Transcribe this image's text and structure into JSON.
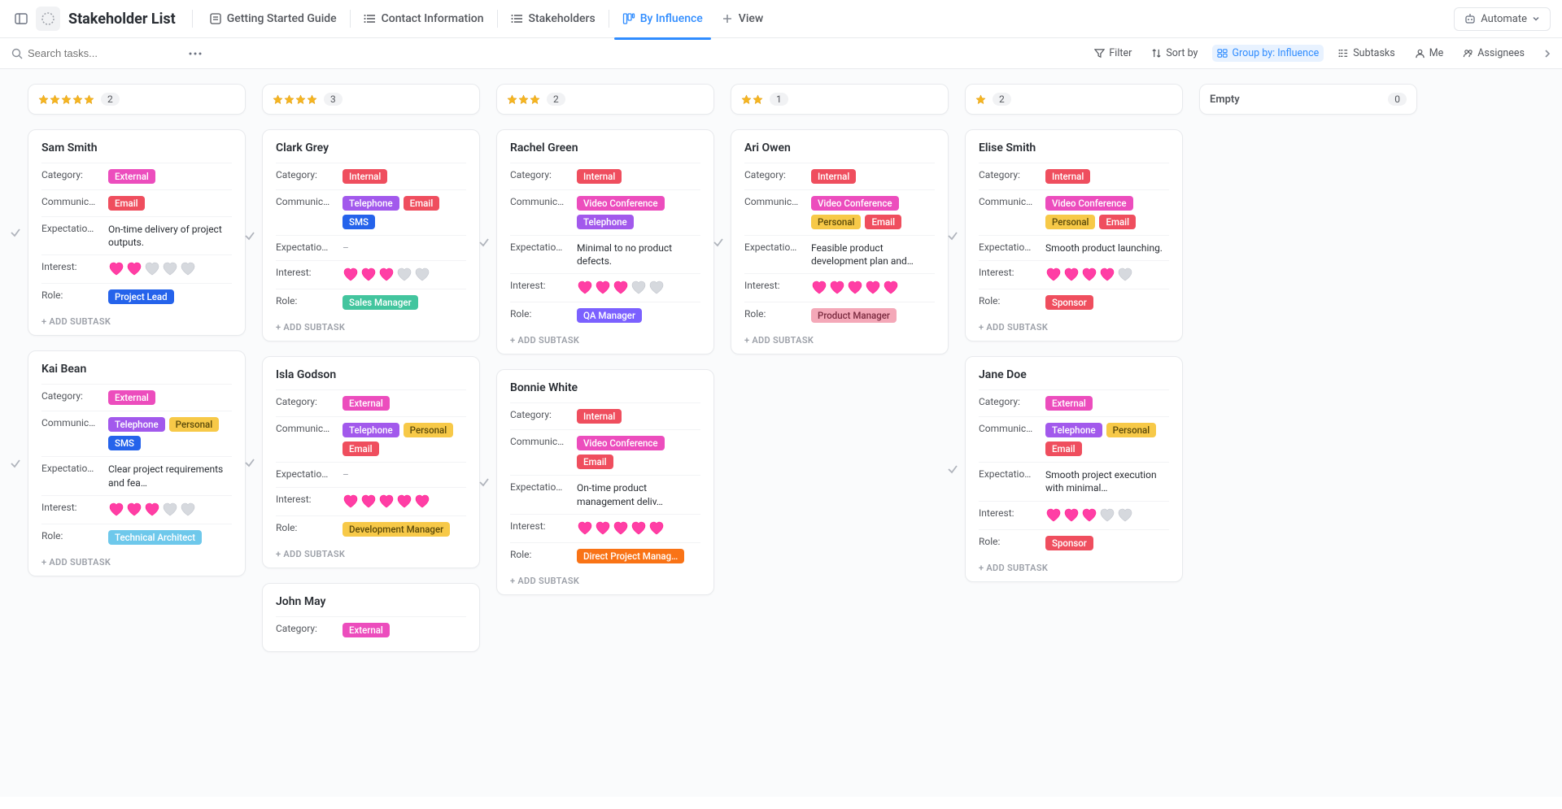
{
  "header": {
    "title": "Stakeholder List",
    "tabs": [
      {
        "label": "Getting Started Guide",
        "active": false
      },
      {
        "label": "Contact Information",
        "active": false
      },
      {
        "label": "Stakeholders",
        "active": false
      },
      {
        "label": "By Influence",
        "active": true
      },
      {
        "label": "View",
        "active": false,
        "isAdd": true
      }
    ],
    "automate": "Automate"
  },
  "toolbar": {
    "search_placeholder": "Search tasks...",
    "items": [
      {
        "icon": "filter",
        "label": "Filter",
        "highlight": false
      },
      {
        "icon": "sort",
        "label": "Sort by",
        "highlight": false
      },
      {
        "icon": "group",
        "label": "Group by: Influence",
        "highlight": true
      },
      {
        "icon": "subtasks",
        "label": "Subtasks",
        "highlight": false
      },
      {
        "icon": "me",
        "label": "Me",
        "highlight": false
      },
      {
        "icon": "assignees",
        "label": "Assignees",
        "highlight": false
      }
    ]
  },
  "labels": {
    "category": "Category:",
    "communication": "Communic…",
    "expectation": "Expectatio…",
    "interest": "Interest:",
    "role": "Role:",
    "add_subtask": "+ ADD SUBTASK",
    "empty": "Empty"
  },
  "tag_colors": {
    "External": "t-external",
    "Internal": "t-internal",
    "Email": "t-email",
    "Telephone": "t-telephone",
    "SMS": "t-sms",
    "Personal": "t-personal",
    "Video Conference": "t-video",
    "Project Lead": "t-project-lead",
    "Sales Manager": "t-sales-manager",
    "Technical Architect": "t-tech-architect",
    "Development Manager": "t-dev-manager",
    "QA Manager": "t-qa-manager",
    "Direct Project Manag…": "t-direct-pm",
    "Product Manager": "t-product-manager",
    "Sponsor": "t-sponsor"
  },
  "columns": [
    {
      "stars": 5,
      "count": 2,
      "cards": [
        {
          "name": "Sam Smith",
          "category": [
            "External"
          ],
          "communication": [
            "Email"
          ],
          "expectation": "On-time delivery of project outputs.",
          "interest": 2,
          "role": [
            "Project Lead"
          ]
        },
        {
          "name": "Kai Bean",
          "category": [
            "External"
          ],
          "communication": [
            "Telephone",
            "Personal",
            "SMS"
          ],
          "expectation": "Clear project requirements and fea…",
          "interest": 3,
          "role": [
            "Technical Architect"
          ]
        }
      ]
    },
    {
      "stars": 4,
      "count": 3,
      "cards": [
        {
          "name": "Clark Grey",
          "category": [
            "Internal"
          ],
          "communication": [
            "Telephone",
            "Email",
            "SMS"
          ],
          "expectation": "–",
          "interest": 3,
          "role": [
            "Sales Manager"
          ]
        },
        {
          "name": "Isla Godson",
          "category": [
            "External"
          ],
          "communication": [
            "Telephone",
            "Personal",
            "Email"
          ],
          "expectation": "–",
          "interest": 5,
          "role": [
            "Development Manager"
          ]
        },
        {
          "name": "John May",
          "category": [
            "External"
          ],
          "communication": [],
          "expectation": null,
          "interest": null,
          "role": [],
          "truncated": true
        }
      ]
    },
    {
      "stars": 3,
      "count": 2,
      "cards": [
        {
          "name": "Rachel Green",
          "category": [
            "Internal"
          ],
          "communication": [
            "Video Conference",
            "Telephone"
          ],
          "expectation": "Minimal to no product defects.",
          "interest": 3,
          "role": [
            "QA Manager"
          ]
        },
        {
          "name": "Bonnie White",
          "category": [
            "Internal"
          ],
          "communication": [
            "Video Conference",
            "Email"
          ],
          "expectation": "On-time product management deliv…",
          "interest": 5,
          "role": [
            "Direct Project Manag…"
          ]
        }
      ]
    },
    {
      "stars": 2,
      "count": 1,
      "cards": [
        {
          "name": "Ari Owen",
          "category": [
            "Internal"
          ],
          "communication": [
            "Video Conference",
            "Personal",
            "Email"
          ],
          "expectation": "Feasible product development plan and…",
          "interest": 5,
          "role": [
            "Product Manager"
          ]
        }
      ]
    },
    {
      "stars": 1,
      "count": 2,
      "cards": [
        {
          "name": "Elise Smith",
          "category": [
            "Internal"
          ],
          "communication": [
            "Video Conference",
            "Personal",
            "Email"
          ],
          "expectation": "Smooth product launching.",
          "interest": 4,
          "role": [
            "Sponsor"
          ]
        },
        {
          "name": "Jane Doe",
          "category": [
            "External"
          ],
          "communication": [
            "Telephone",
            "Personal",
            "Email"
          ],
          "expectation": "Smooth project execution with minimal…",
          "interest": 3,
          "role": [
            "Sponsor"
          ]
        }
      ]
    },
    {
      "stars": 0,
      "count": 0,
      "empty": true,
      "cards": []
    }
  ]
}
